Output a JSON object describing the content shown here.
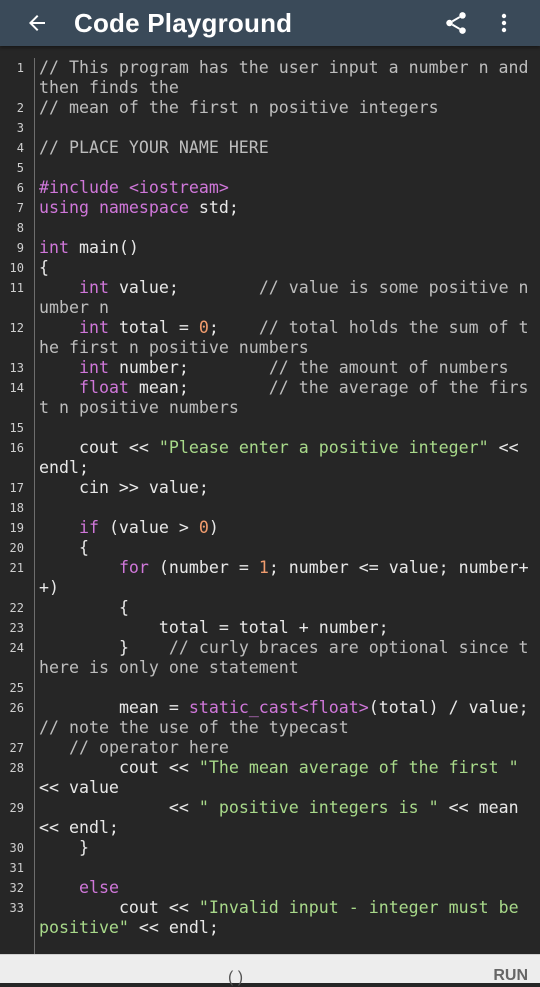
{
  "app_bar": {
    "back_icon": "arrow-back-icon",
    "title": "Code Playground",
    "share_icon": "share-icon",
    "more_icon": "more-vertical-icon"
  },
  "editor": {
    "lines": [
      {
        "n": "1",
        "html": "<span class='c-com'>// This program has the user input a number n and then finds the</span>"
      },
      {
        "n": "2",
        "html": "<span class='c-com'>// mean of the first n positive integers</span>"
      },
      {
        "n": "3",
        "html": ""
      },
      {
        "n": "4",
        "html": "<span class='c-com'>// PLACE YOUR NAME HERE</span>"
      },
      {
        "n": "5",
        "html": ""
      },
      {
        "n": "6",
        "html": "<span class='c-kw'>#include</span> <span class='c-kw'>&lt;iostream&gt;</span>"
      },
      {
        "n": "7",
        "html": "<span class='c-kw'>using namespace</span> std;"
      },
      {
        "n": "8",
        "html": ""
      },
      {
        "n": "9",
        "html": "<span class='c-kw'>int</span> main()"
      },
      {
        "n": "10",
        "html": "{"
      },
      {
        "n": "11",
        "html": "    <span class='c-kw'>int</span> value;        <span class='c-com'>// value is some positive number n</span>"
      },
      {
        "n": "12",
        "html": "    <span class='c-kw'>int</span> total = <span class='c-num'>0</span>;    <span class='c-com'>// total holds the sum of the first n positive numbers</span>"
      },
      {
        "n": "13",
        "html": "    <span class='c-kw'>int</span> number;        <span class='c-com'>// the amount of numbers</span>"
      },
      {
        "n": "14",
        "html": "    <span class='c-kw'>float</span> mean;        <span class='c-com'>// the average of the first n positive numbers</span>"
      },
      {
        "n": "15",
        "html": ""
      },
      {
        "n": "16",
        "html": "    cout &lt;&lt; <span class='c-str'>\"Please enter a positive integer\"</span> &lt;&lt; endl;"
      },
      {
        "n": "17",
        "html": "    cin &gt;&gt; value;"
      },
      {
        "n": "18",
        "html": ""
      },
      {
        "n": "19",
        "html": "    <span class='c-kw'>if</span> (value &gt; <span class='c-num'>0</span>)"
      },
      {
        "n": "20",
        "html": "    {"
      },
      {
        "n": "21",
        "html": "        <span class='c-kw'>for</span> (number = <span class='c-num'>1</span>; number &lt;= value; number++)"
      },
      {
        "n": "22",
        "html": "        {"
      },
      {
        "n": "23",
        "html": "            total = total + number;"
      },
      {
        "n": "24",
        "html": "        }    <span class='c-com'>// curly braces are optional since there is only one statement</span>"
      },
      {
        "n": "25",
        "html": ""
      },
      {
        "n": "26",
        "html": "        mean = <span class='c-kw'>static_cast</span><span class='c-kw'>&lt;float&gt;</span>(total) / value;    <span class='c-com'>// note the use of the typecast</span>"
      },
      {
        "n": "27",
        "html": "   <span class='c-com'>// operator here</span>"
      },
      {
        "n": "28",
        "html": "        cout &lt;&lt; <span class='c-str'>\"The mean average of the first \"</span> &lt;&lt; value"
      },
      {
        "n": "29",
        "html": "             &lt;&lt; <span class='c-str'>\" positive integers is \"</span> &lt;&lt; mean &lt;&lt; endl;"
      },
      {
        "n": "30",
        "html": "    }"
      },
      {
        "n": "31",
        "html": ""
      },
      {
        "n": "32",
        "html": "    <span class='c-kw'>else</span>"
      },
      {
        "n": "33",
        "html": "        cout &lt;&lt; <span class='c-str'>\"Invalid input - integer must be positive\"</span> &lt;&lt; endl;"
      }
    ]
  },
  "bottom_bar": {
    "left_text": "(        )",
    "run_label": "RUN"
  },
  "colors": {
    "app_bar": "#3a4a59",
    "editor_bg": "#262626",
    "keyword": "#cf77d9",
    "string": "#a8d98a",
    "number": "#f09c6e",
    "comment": "#bdbdbd"
  }
}
